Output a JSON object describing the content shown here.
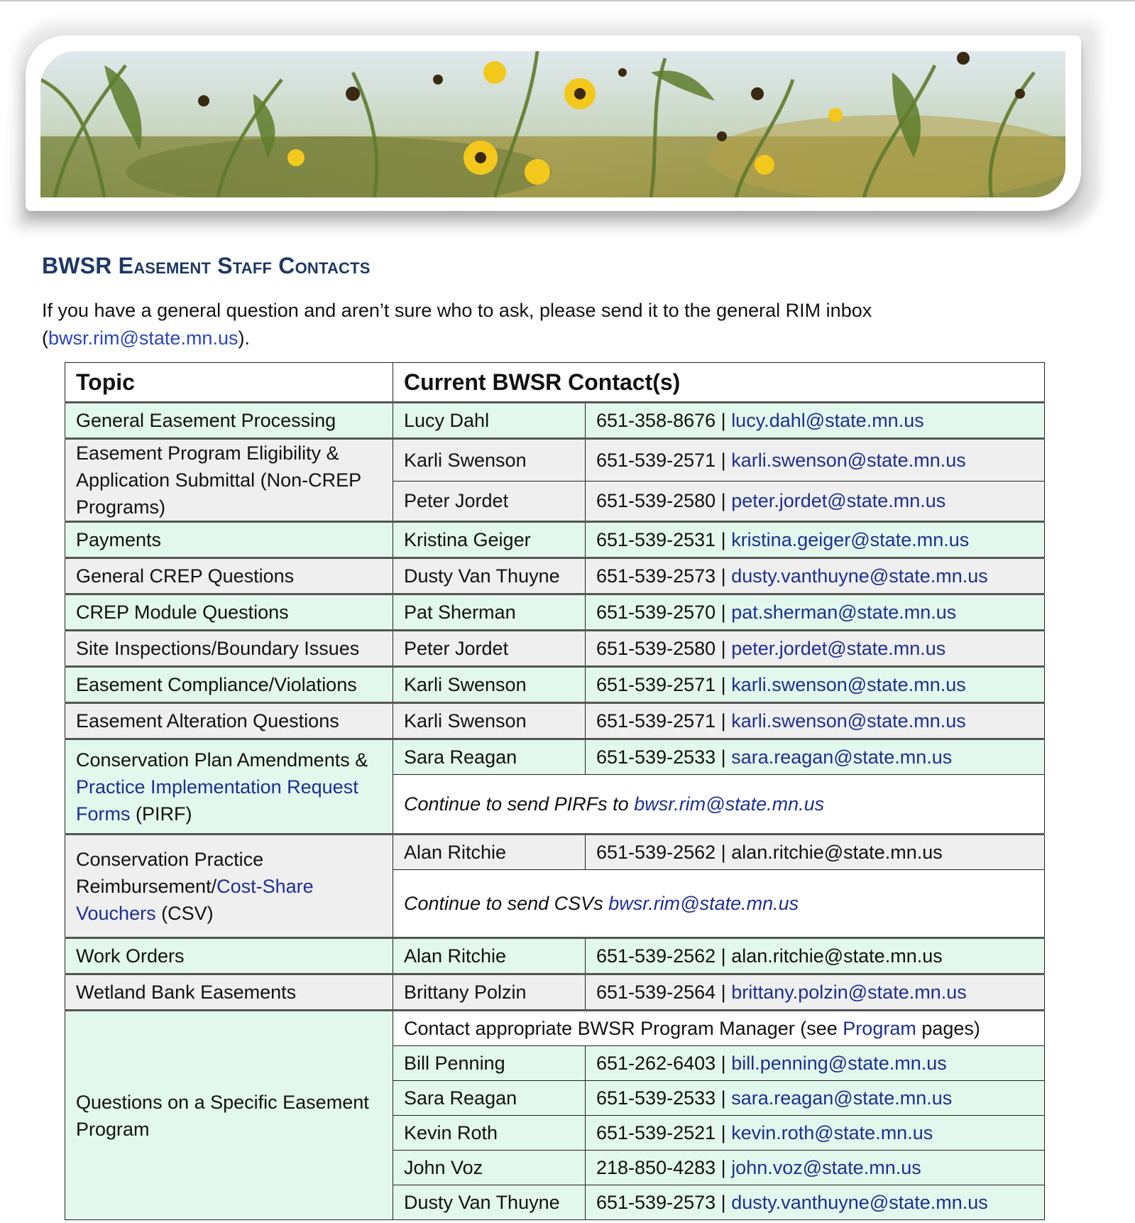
{
  "banner": {
    "alt_name": "prairie-wildflowers-banner"
  },
  "heading": "BWSR Easement Staff Contacts",
  "intro": {
    "text_before": "If you have a general question and aren’t sure who to ask, please send it to the general RIM inbox (",
    "email": "bwsr.rim@state.mn.us",
    "text_after": ")."
  },
  "table": {
    "headers": {
      "topic": "Topic",
      "contacts": "Current BWSR Contact(s)"
    },
    "rows": [
      {
        "topic": "General Easement Processing",
        "name": "Lucy Dahl",
        "phone": "651-358-8676",
        "email": "lucy.dahl@state.mn.us"
      },
      {
        "topic": "Easement Program Eligibility & Application Submittal (Non-CREP Programs)",
        "contacts": [
          {
            "name": "Karli Swenson",
            "phone": "651-539-2571",
            "email": "karli.swenson@state.mn.us"
          },
          {
            "name": "Peter Jordet",
            "phone": "651-539-2580",
            "email": "peter.jordet@state.mn.us"
          }
        ]
      },
      {
        "topic": "Payments",
        "name": "Kristina Geiger",
        "phone": "651-539-2531",
        "email": "kristina.geiger@state.mn.us"
      },
      {
        "topic": "General CREP Questions",
        "name": "Dusty Van Thuyne",
        "phone": "651-539-2573",
        "email": "dusty.vanthuyne@state.mn.us"
      },
      {
        "topic": "CREP Module Questions",
        "name": "Pat Sherman",
        "phone": "651-539-2570",
        "email": "pat.sherman@state.mn.us"
      },
      {
        "topic": "Site Inspections/Boundary Issues",
        "name": "Peter Jordet",
        "phone": "651-539-2580",
        "email": "peter.jordet@state.mn.us"
      },
      {
        "topic": "Easement Compliance/Violations",
        "name": "Karli Swenson",
        "phone": "651-539-2571",
        "email": "karli.swenson@state.mn.us"
      },
      {
        "topic": "Easement Alteration Questions",
        "name": "Karli Swenson",
        "phone": "651-539-2571",
        "email": "karli.swenson@state.mn.us"
      },
      {
        "topic_pre": "Conservation Plan Amendments &",
        "topic_link": "Practice Implementation Request Forms",
        "topic_post": "(PIRF)",
        "name": "Sara Reagan",
        "phone": "651-539-2533",
        "email": "sara.reagan@state.mn.us",
        "note_text": "Continue to send PIRFs to",
        "note_email": "bwsr.rim@state.mn.us"
      },
      {
        "topic_pre": "Conservation Practice Reimbursement/",
        "topic_link": "Cost-Share Vouchers",
        "topic_post": "(CSV)",
        "name": "Alan Ritchie",
        "phone": "651-539-2562",
        "email": "alan.ritchie@state.mn.us",
        "note_text": "Continue to send CSVs",
        "note_email": "bwsr.rim@state.mn.us"
      },
      {
        "topic": "Work Orders",
        "name": "Alan Ritchie",
        "phone": "651-539-2562",
        "email": "alan.ritchie@state.mn.us"
      },
      {
        "topic": "Wetland Bank Easements",
        "name": "Brittany Polzin",
        "phone": "651-539-2564",
        "email": "brittany.polzin@state.mn.us"
      },
      {
        "topic": "Questions on a Specific Easement Program",
        "note_pre": "Contact appropriate BWSR Program Manager (see",
        "note_link": "Program",
        "note_post": "pages)",
        "contacts": [
          {
            "name": "Bill Penning",
            "phone": "651-262-6403",
            "email": "bill.penning@state.mn.us"
          },
          {
            "name": "Sara Reagan",
            "phone": "651-539-2533",
            "email": "sara.reagan@state.mn.us"
          },
          {
            "name": "Kevin Roth",
            "phone": "651-539-2521",
            "email": "kevin.roth@state.mn.us"
          },
          {
            "name": "John Voz",
            "phone": "218-850-4283",
            "email": "john.voz@state.mn.us"
          },
          {
            "name": "Dusty Van Thuyne",
            "phone": "651-539-2573",
            "email": "dusty.vanthuyne@state.mn.us"
          }
        ]
      }
    ],
    "separator": " | "
  }
}
